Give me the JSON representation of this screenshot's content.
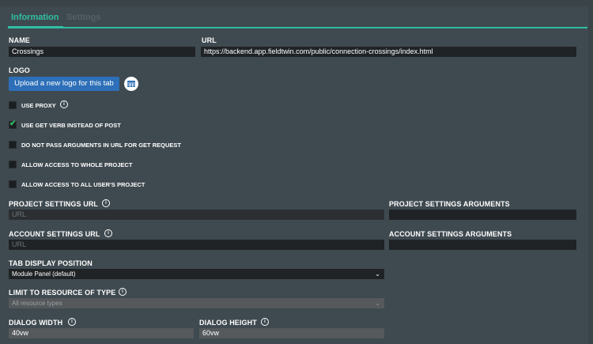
{
  "tabs": [
    {
      "label": "Information",
      "active": true
    },
    {
      "label": "Settings",
      "active": false
    }
  ],
  "name": {
    "label": "NAME",
    "value": "Crossings"
  },
  "url": {
    "label": "URL",
    "value": "https://backend.app.fieldtwin.com/public/connection-crossings/index.html"
  },
  "logo": {
    "label": "LOGO",
    "upload_button": "Upload a new logo for this tab",
    "icon": "table-icon"
  },
  "checkboxes": [
    {
      "label": "USE PROXY",
      "checked": false,
      "info": true
    },
    {
      "label": "USE GET VERB INSTEAD OF POST",
      "checked": true,
      "info": false
    },
    {
      "label": "DO NOT PASS ARGUMENTS IN URL FOR GET REQUEST",
      "checked": false,
      "info": false
    },
    {
      "label": "ALLOW ACCESS TO WHOLE PROJECT",
      "checked": false,
      "info": false
    },
    {
      "label": "ALLOW ACCESS TO ALL USER'S PROJECT",
      "checked": false,
      "info": false
    }
  ],
  "project_settings_url": {
    "label": "PROJECT SETTINGS URL",
    "placeholder": "URL"
  },
  "project_settings_args": {
    "label": "PROJECT SETTINGS ARGUMENTS",
    "value": ""
  },
  "account_settings_url": {
    "label": "ACCOUNT SETTINGS URL",
    "placeholder": "URL"
  },
  "account_settings_args": {
    "label": "ACCOUNT SETTINGS ARGUMENTS",
    "value": ""
  },
  "tab_display_position": {
    "label": "TAB DISPLAY POSITION",
    "selected": "Module Panel (default)"
  },
  "limit_resource_type": {
    "label": "LIMIT TO RESOURCE OF TYPE",
    "selected": "All resource types"
  },
  "dialog_width": {
    "label": "DIALOG WIDTH",
    "value": "40vw"
  },
  "dialog_height": {
    "label": "DIALOG HEIGHT",
    "value": "60vw"
  },
  "colors": {
    "accent": "#2fbfa3",
    "button": "#2d6fb8",
    "check": "#2fbf63",
    "background": "#3f4a50"
  }
}
